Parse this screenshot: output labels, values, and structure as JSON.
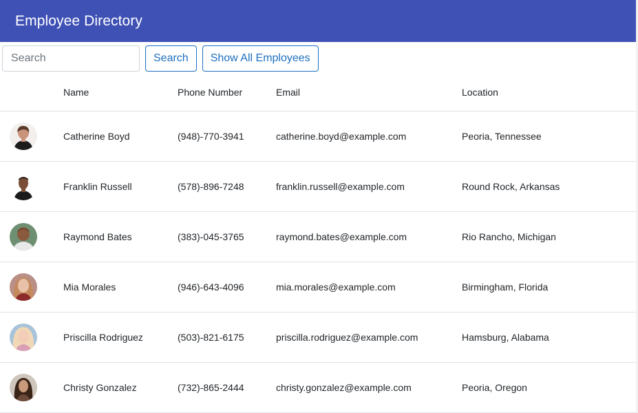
{
  "header": {
    "title": "Employee Directory"
  },
  "search": {
    "placeholder": "Search",
    "value": "",
    "search_label": "Search",
    "show_all_label": "Show All Employees"
  },
  "table": {
    "columns": [
      "",
      "Name",
      "Phone Number",
      "Email",
      "Location"
    ],
    "rows": [
      {
        "name": "Catherine Boyd",
        "phone": "(948)-770-3941",
        "email": "catherine.boyd@example.com",
        "location": "Peoria, Tennessee"
      },
      {
        "name": "Franklin Russell",
        "phone": "(578)-896-7248",
        "email": "franklin.russell@example.com",
        "location": "Round Rock, Arkansas"
      },
      {
        "name": "Raymond Bates",
        "phone": "(383)-045-3765",
        "email": "raymond.bates@example.com",
        "location": "Rio Rancho, Michigan"
      },
      {
        "name": "Mia Morales",
        "phone": "(946)-643-4096",
        "email": "mia.morales@example.com",
        "location": "Birmingham, Florida"
      },
      {
        "name": "Priscilla Rodriguez",
        "phone": "(503)-821-6175",
        "email": "priscilla.rodriguez@example.com",
        "location": "Hamsburg, Alabama"
      },
      {
        "name": "Christy Gonzalez",
        "phone": "(732)-865-2444",
        "email": "christy.gonzalez@example.com",
        "location": "Peoria, Oregon"
      }
    ]
  },
  "colors": {
    "header_bg": "#3f51b5",
    "header_text": "#ffffff",
    "button_accent": "#1d6fbf",
    "row_border": "#dee2e6"
  }
}
